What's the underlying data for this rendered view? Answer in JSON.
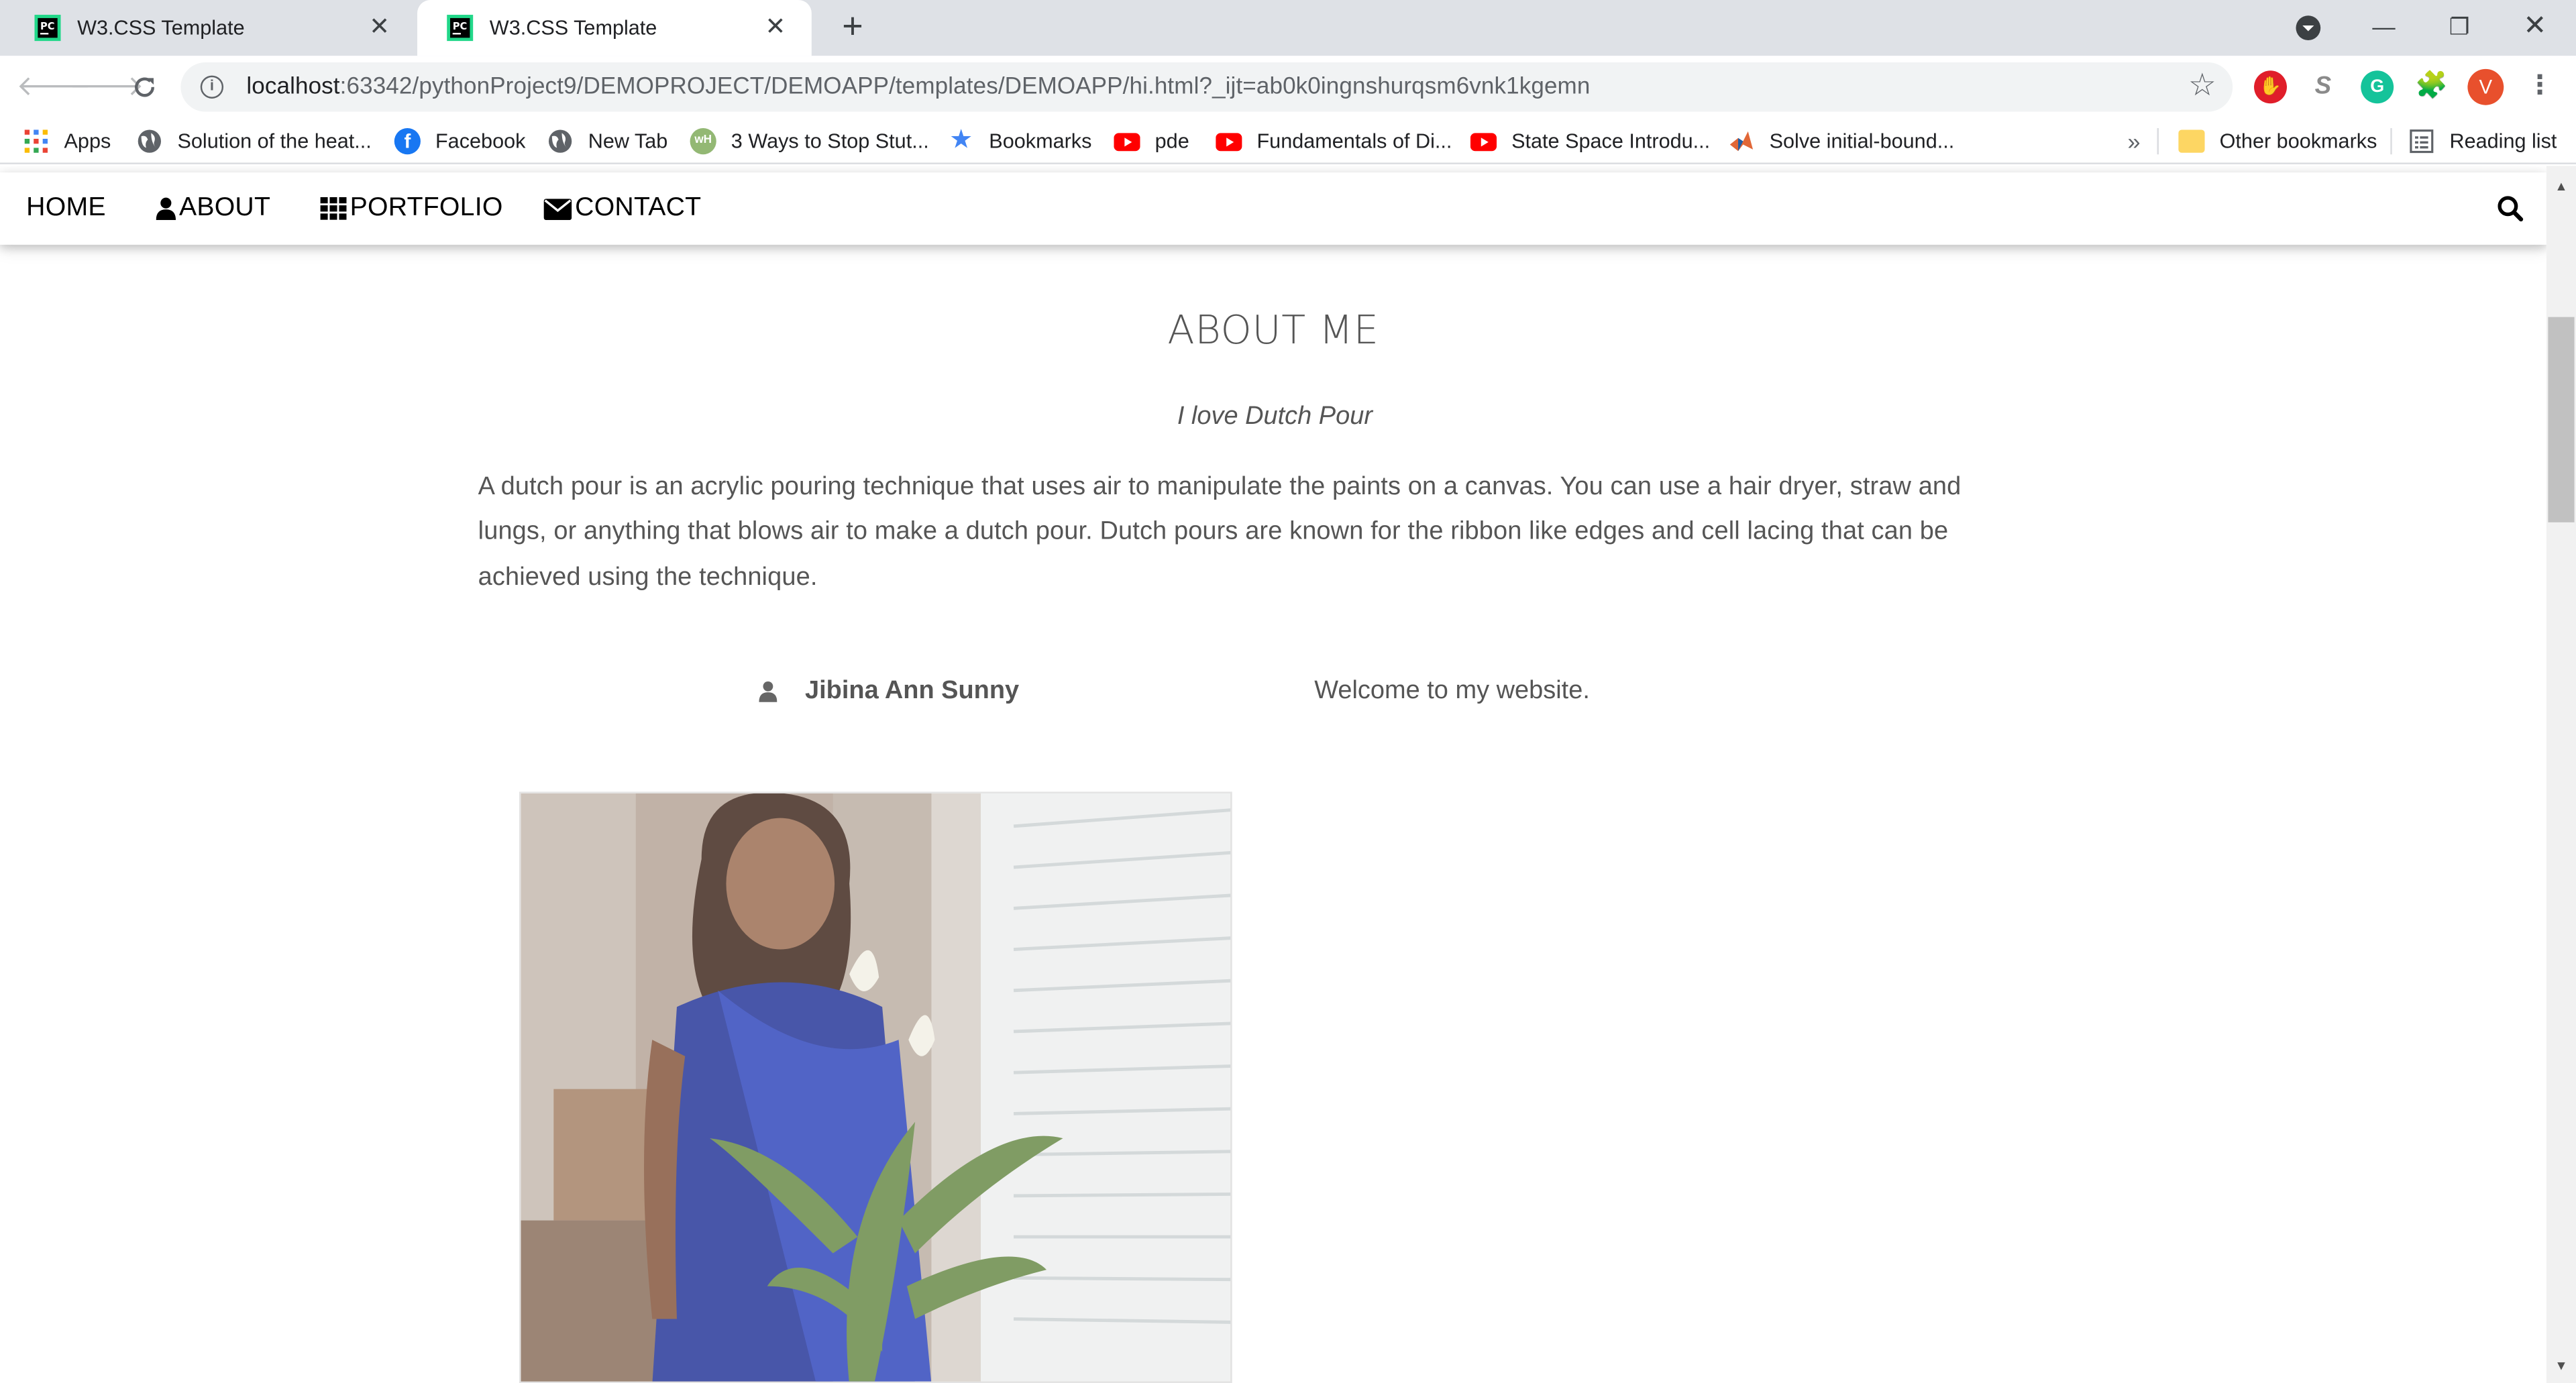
{
  "browser": {
    "tabs": [
      {
        "title": "W3.CSS Template",
        "active": false
      },
      {
        "title": "W3.CSS Template",
        "active": true
      }
    ],
    "url_host": "localhost",
    "url_rest": ":63342/pythonProject9/DEMOPROJECT/DEMOAPP/templates/DEMOAPP/hi.html?_ijt=ab0k0ingnshurqsm6vnk1kgemn",
    "profile_initial": "V",
    "bookmarks": [
      {
        "label": "Apps",
        "icon": "apps-grid-icon"
      },
      {
        "label": "Solution of the heat...",
        "icon": "globe-icon"
      },
      {
        "label": "Facebook",
        "icon": "facebook-icon"
      },
      {
        "label": "New Tab",
        "icon": "globe-icon"
      },
      {
        "label": "3 Ways to Stop Stut...",
        "icon": "wikihow-icon"
      },
      {
        "label": "Bookmarks",
        "icon": "star-icon"
      },
      {
        "label": "pde",
        "icon": "youtube-icon"
      },
      {
        "label": "Fundamentals of Di...",
        "icon": "youtube-icon"
      },
      {
        "label": "State Space Introdu...",
        "icon": "youtube-icon"
      },
      {
        "label": "Solve initial-bound...",
        "icon": "matlab-icon"
      }
    ],
    "overflow_chevron": "»",
    "other_bookmarks": "Other bookmarks",
    "reading_list": "Reading list"
  },
  "site": {
    "nav": [
      {
        "label": "HOME",
        "icon": ""
      },
      {
        "label": "ABOUT",
        "icon": "user-icon"
      },
      {
        "label": "PORTFOLIO",
        "icon": "grid-icon"
      },
      {
        "label": "CONTACT",
        "icon": "envelope-icon"
      }
    ],
    "about": {
      "title": "ABOUT ME",
      "subtitle": "I love Dutch Pour",
      "paragraph": "A dutch pour is an acrylic pouring technique that uses air to manipulate the paints on a canvas. You can use a hair dryer, straw and lungs, or anything that blows air to make a dutch pour. Dutch pours are known for the ribbon like edges and cell lacing that can be achieved using the technique.",
      "name": "Jibina Ann Sunny",
      "welcome": "Welcome to my website."
    }
  },
  "colors": {
    "tabstrip": "#dee1e6",
    "omnibox": "#f1f3f4",
    "text_gray": "#555555",
    "avatar": "#e8502d"
  }
}
